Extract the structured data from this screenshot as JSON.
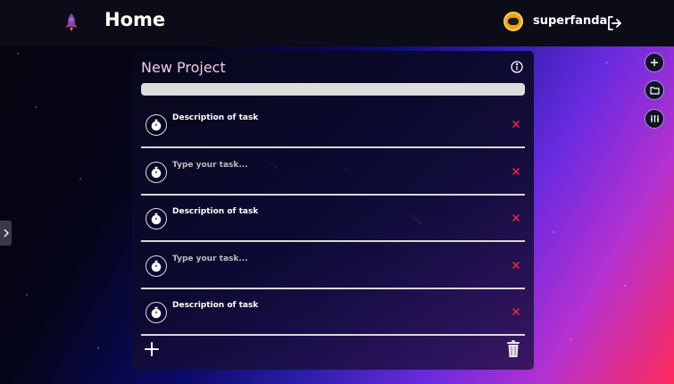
{
  "header": {
    "title": "Home",
    "username": "superfanda"
  },
  "project": {
    "title": "New Project",
    "progress_percent": 0,
    "tasks": [
      {
        "text": "Description of task",
        "placeholder": ""
      },
      {
        "text": "",
        "placeholder": "Type your task..."
      },
      {
        "text": "Description of task",
        "placeholder": ""
      },
      {
        "text": "",
        "placeholder": "Type your task..."
      },
      {
        "text": "Description of task",
        "placeholder": ""
      }
    ]
  },
  "icons": {
    "logo": "rocket-icon",
    "logout": "logout-icon",
    "sidebar_toggle": "chevron-right-icon",
    "tools": [
      "plus-icon",
      "folder-icon",
      "sliders-icon"
    ],
    "info": "info-icon",
    "task_timer": "stopwatch-icon",
    "task_delete": "close-icon",
    "add_task": "plus-icon",
    "delete_project": "trash-icon"
  },
  "colors": {
    "header_bg": "#0b0c17",
    "delete_x": "#e0263a",
    "project_title": "#f3cbe0",
    "avatar": "#f0a020"
  }
}
